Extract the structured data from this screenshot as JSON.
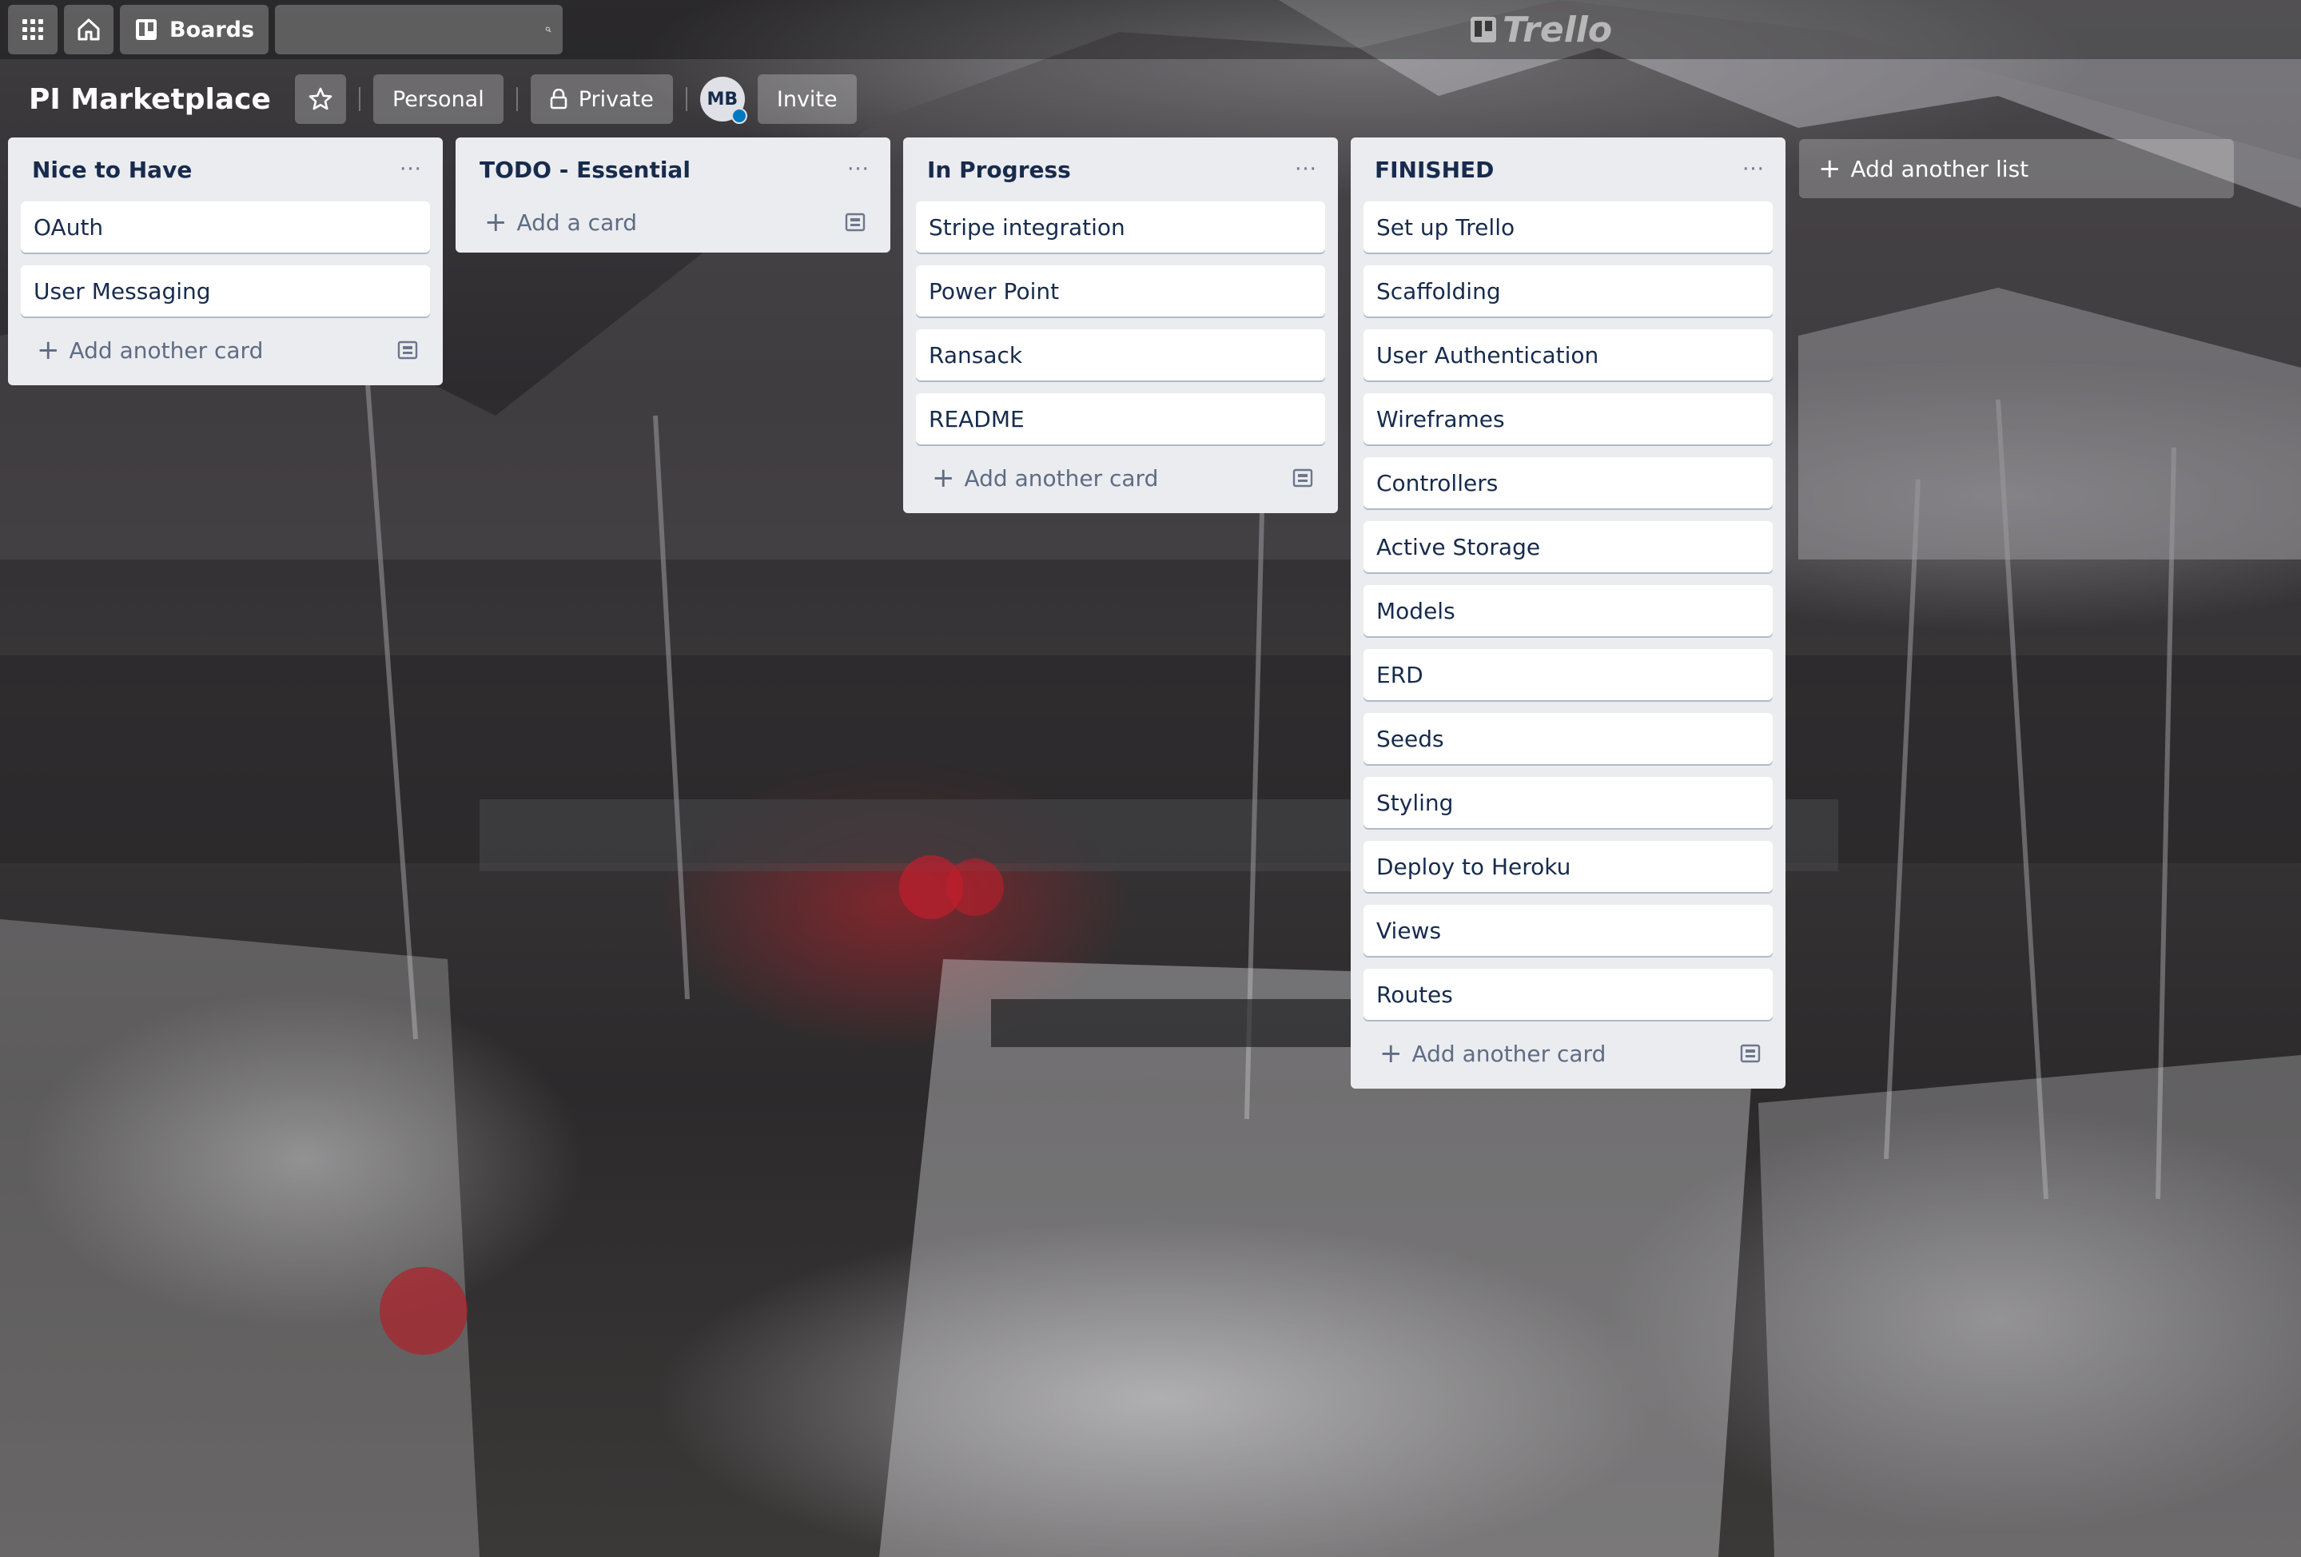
{
  "topbar": {
    "boards_label": "Boards",
    "search_placeholder": "",
    "logo_text": "Trello"
  },
  "board": {
    "title": "PI Marketplace",
    "visibility_team": "Personal",
    "visibility_privacy": "Private",
    "member_initials": "MB",
    "invite_label": "Invite"
  },
  "lists": [
    {
      "title": "Nice to Have",
      "cards": [
        "OAuth",
        "User Messaging"
      ],
      "add_label": "Add another card"
    },
    {
      "title": "TODO - Essential",
      "cards": [],
      "add_label": "Add a card"
    },
    {
      "title": "In Progress",
      "cards": [
        "Stripe integration",
        "Power Point",
        "Ransack",
        "README"
      ],
      "add_label": "Add another card"
    },
    {
      "title": "FINISHED",
      "cards": [
        "Set up Trello",
        "Scaffolding",
        "User Authentication",
        "Wireframes",
        "Controllers",
        "Active Storage",
        "Models",
        "ERD",
        "Seeds",
        "Styling",
        "Deploy to Heroku",
        "Views",
        "Routes"
      ],
      "add_label": "Add another card"
    }
  ],
  "add_list_label": "Add another list",
  "menu_glyph": "···",
  "plus_glyph": "+"
}
